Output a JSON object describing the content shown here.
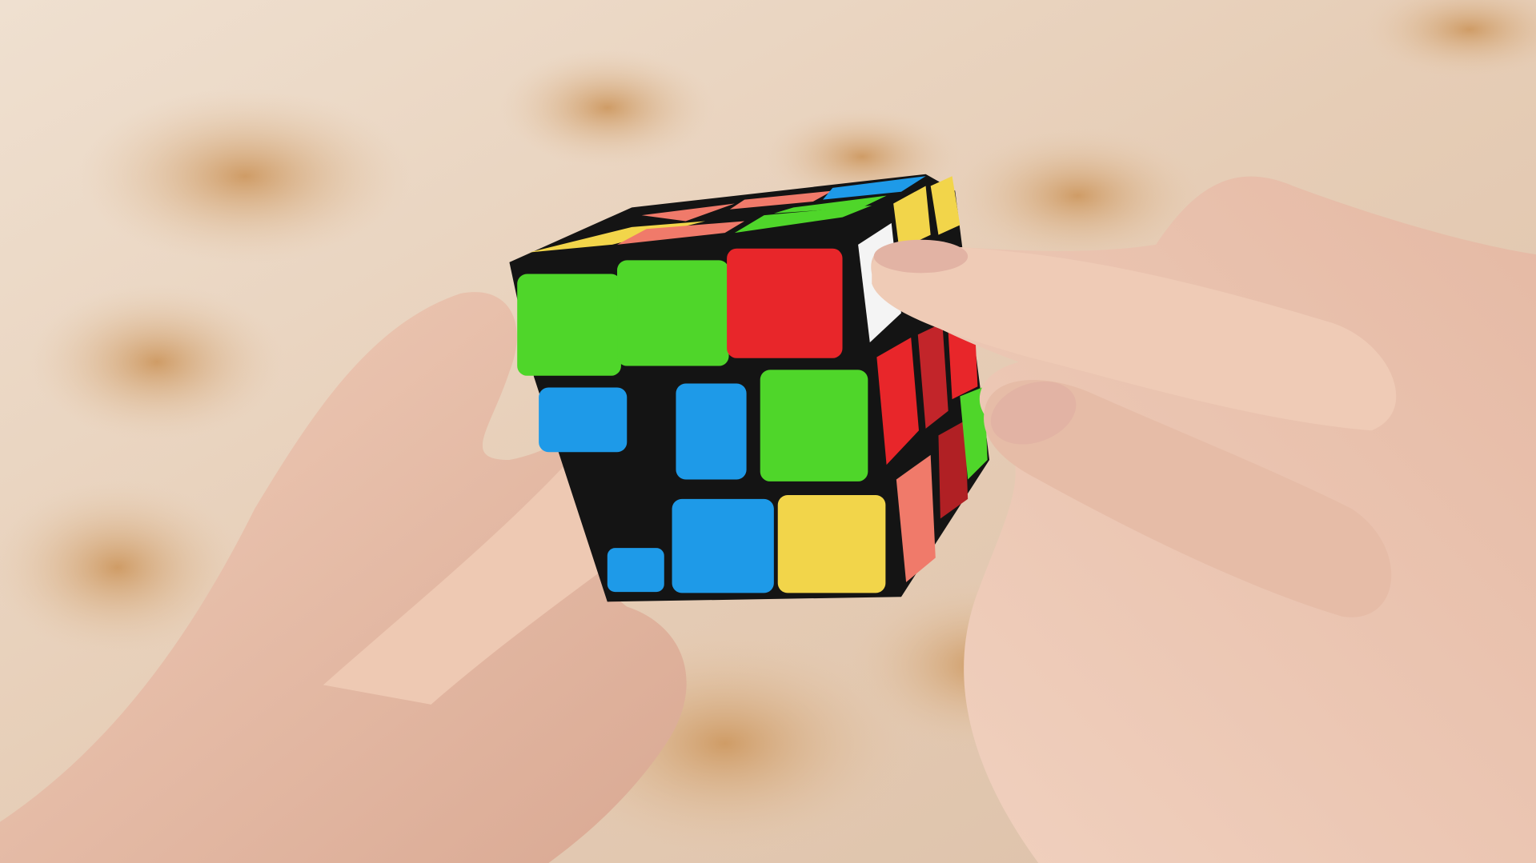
{
  "scene": {
    "subject": "rubiks-cube-in-hands",
    "colors": {
      "tablecloth": "#ead6c2",
      "flower": "#d9a877",
      "cube_body": "#141414",
      "green": "#4fd62a",
      "red": "#e8262a",
      "blue": "#1e9ae8",
      "yellow": "#f2d54a",
      "white": "#f4f4f4",
      "skin": "#e9c3ad",
      "skin_shadow": "#c99a86"
    }
  }
}
